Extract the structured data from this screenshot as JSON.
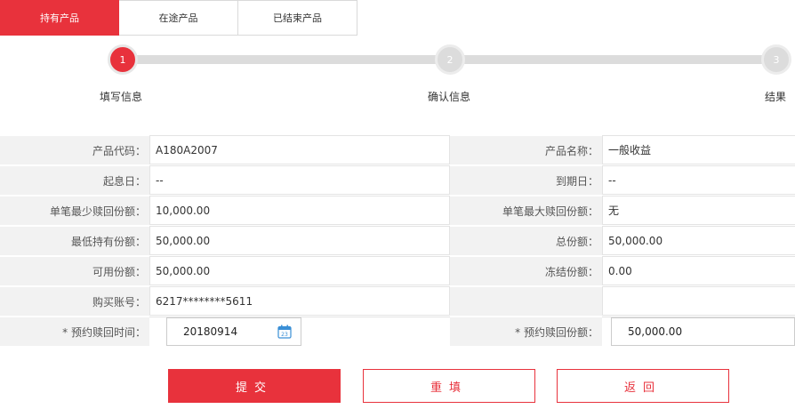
{
  "tabs": [
    {
      "label": "持有产品",
      "active": true
    },
    {
      "label": "在途产品",
      "active": false
    },
    {
      "label": "已结束产品",
      "active": false
    }
  ],
  "steps": [
    {
      "number": "1",
      "label": "填写信息",
      "active": true
    },
    {
      "number": "2",
      "label": "确认信息",
      "active": false
    },
    {
      "number": "3",
      "label": "结果",
      "active": false
    }
  ],
  "form": {
    "product_code_label": "产品代码：",
    "product_code": "A180A2007",
    "product_name_label": "产品名称：",
    "product_name": "一般收益",
    "start_date_label": "起息日：",
    "start_date": "--",
    "end_date_label": "到期日：",
    "end_date": "--",
    "min_redeem_label": "单笔最少赎回份额：",
    "min_redeem": "10,000.00",
    "max_redeem_label": "单笔最大赎回份额：",
    "max_redeem": "无",
    "min_hold_label": "最低持有份额：",
    "min_hold": "50,000.00",
    "total_label": "总份额：",
    "total": "50,000.00",
    "available_label": "可用份额：",
    "available": "50,000.00",
    "frozen_label": "冻结份额：",
    "frozen": "0.00",
    "account_label": "购买账号：",
    "account": "6217********5611",
    "redeem_time_label": "* 预约赎回时间：",
    "redeem_time": "20180914",
    "redeem_amount_label": "* 预约赎回份额：",
    "redeem_amount": "50,000.00",
    "calendar_day": "23"
  },
  "buttons": {
    "submit": "提交",
    "reset": "重填",
    "back": "返回"
  },
  "colors": {
    "accent": "#e8323c",
    "label_bg": "#f2f2f2"
  }
}
